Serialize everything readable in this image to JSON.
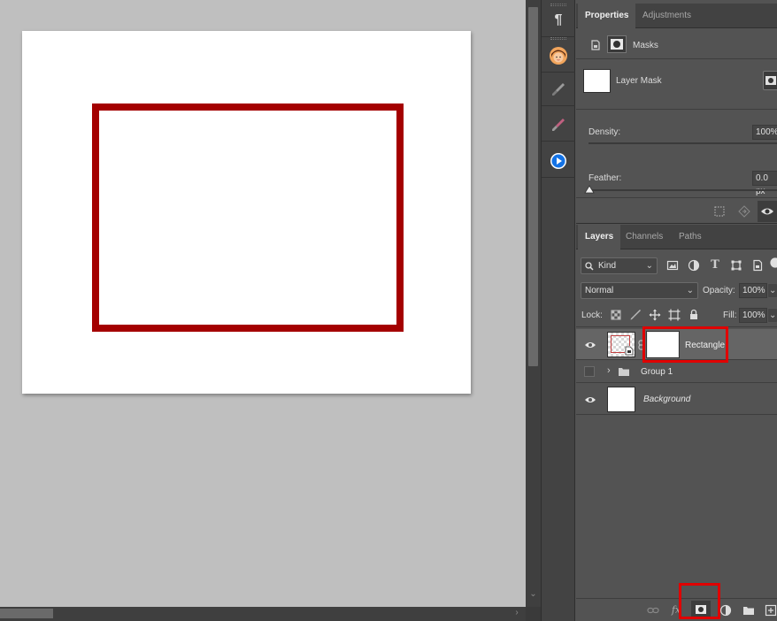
{
  "properties_panel": {
    "tabs": [
      "Properties",
      "Adjustments"
    ],
    "section_title": "Masks",
    "layer_mask_label": "Layer Mask",
    "density_label": "Density:",
    "density_value": "100%",
    "feather_label": "Feather:",
    "feather_value": "0.0 px"
  },
  "layers_panel": {
    "tabs": [
      "Layers",
      "Channels",
      "Paths"
    ],
    "filter_kind": "Kind",
    "blend_mode": "Normal",
    "opacity_label": "Opacity:",
    "opacity_value": "100%",
    "lock_label": "Lock:",
    "fill_label": "Fill:",
    "fill_value": "100%",
    "layers": [
      {
        "name": "Rectangle"
      },
      {
        "name": "Group 1"
      },
      {
        "name": "Background"
      }
    ]
  },
  "colors": {
    "rectangle_stroke": "#a40000",
    "highlight": "#e00000",
    "panel_bg": "#535353",
    "canvas_bg": "#bfbfbf"
  }
}
